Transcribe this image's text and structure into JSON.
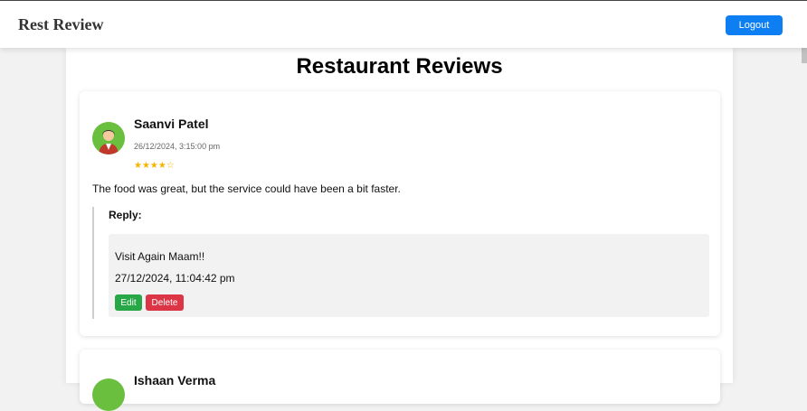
{
  "navbar": {
    "brand": "Rest Review",
    "logout_label": "Logout"
  },
  "page": {
    "title": "Restaurant Reviews"
  },
  "reviews": [
    {
      "name": "Saanvi Patel",
      "date": "26/12/2024, 3:15:00 pm",
      "stars": "★★★★☆",
      "rating": 4,
      "text": "The food was great, but the service could have been a bit faster.",
      "reply_label": "Reply:",
      "reply_text": "Visit Again Maam!!",
      "reply_date": "27/12/2024, 11:04:42 pm",
      "edit_label": "Edit",
      "delete_label": "Delete"
    },
    {
      "name": "Ishaan Verma"
    }
  ],
  "colors": {
    "primary": "#0d7ff2",
    "success": "#27a745",
    "danger": "#dc3545",
    "star": "#f5b400"
  }
}
